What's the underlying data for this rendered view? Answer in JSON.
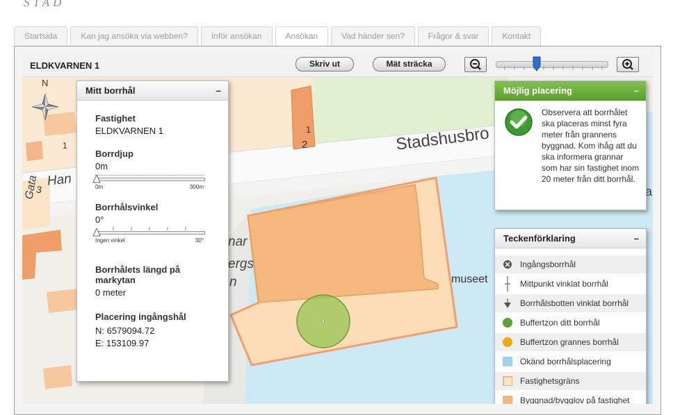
{
  "logo_text": "STAD",
  "nav": {
    "tabs": [
      "Startsida",
      "Kan jag ansöka via webben?",
      "Inför ansökan",
      "Ansökan",
      "Vad händer sen?",
      "Frågor & svar",
      "Kontakt"
    ],
    "active": "Ansökan"
  },
  "toolbar": {
    "property": "ELDKVARNEN 1",
    "print_label": "Skriv ut",
    "measure_label": "Mät sträcka",
    "zoom_level": 0.4
  },
  "map": {
    "compass": "N",
    "labels": {
      "street1": "Stadshusbro",
      "street2": "Han",
      "gata": "Gata",
      "museum": "museet",
      "nar": "nar",
      "ergs": "ergs",
      "n": "n",
      "num1": "1",
      "num2": "2",
      "num3": "3",
      "num4": "1",
      "num5": "1",
      "num6": "3",
      "num7": "a"
    }
  },
  "borehole_panel": {
    "title": "Mitt borrhål",
    "property_label": "Fastighet",
    "property_value": "ELDKVARNEN 1",
    "depth_label": "Borrdjup",
    "depth_value": "0m",
    "depth_min": "0m",
    "depth_max": "300m",
    "angle_label": "Borrhålsvinkel",
    "angle_value": "0°",
    "angle_min": "Ingen vinkel",
    "angle_max": "30°",
    "length_label": "Borrhålets längd på markytan",
    "length_value": "0 meter",
    "position_label": "Placering ingångshål",
    "n_coord": "N: 6579094.72",
    "e_coord": "E: 153109.97"
  },
  "placement_panel": {
    "title": "Möjlig placering",
    "message": "Observera att borrhålet ska placeras minst fyra meter från grannens byggnad. Kom ihåg att du ska informera grannar som har sin fastighet inom 20 meter från ditt borrhål."
  },
  "legend": {
    "title": "Teckenförklaring",
    "items": [
      "Ingångsborrhål",
      "Mittpunkt vinklat borrhål",
      "Borrhålsbotten vinklat borrhål",
      "Buffertzon ditt borrhål",
      "Buffertzon grannes borrhål",
      "Okänd borrhålsplacering",
      "Fastighetsgräns",
      "Byggnad/bygglov på fastighet"
    ]
  },
  "colors": {
    "green_header": "#6cae3e",
    "buffer_green": "#5aa532",
    "buffer_orange": "#f0a818",
    "unknown_blue": "#9fd3ea",
    "property_orange": "#f0a070",
    "building_orange": "#f5b77e"
  }
}
